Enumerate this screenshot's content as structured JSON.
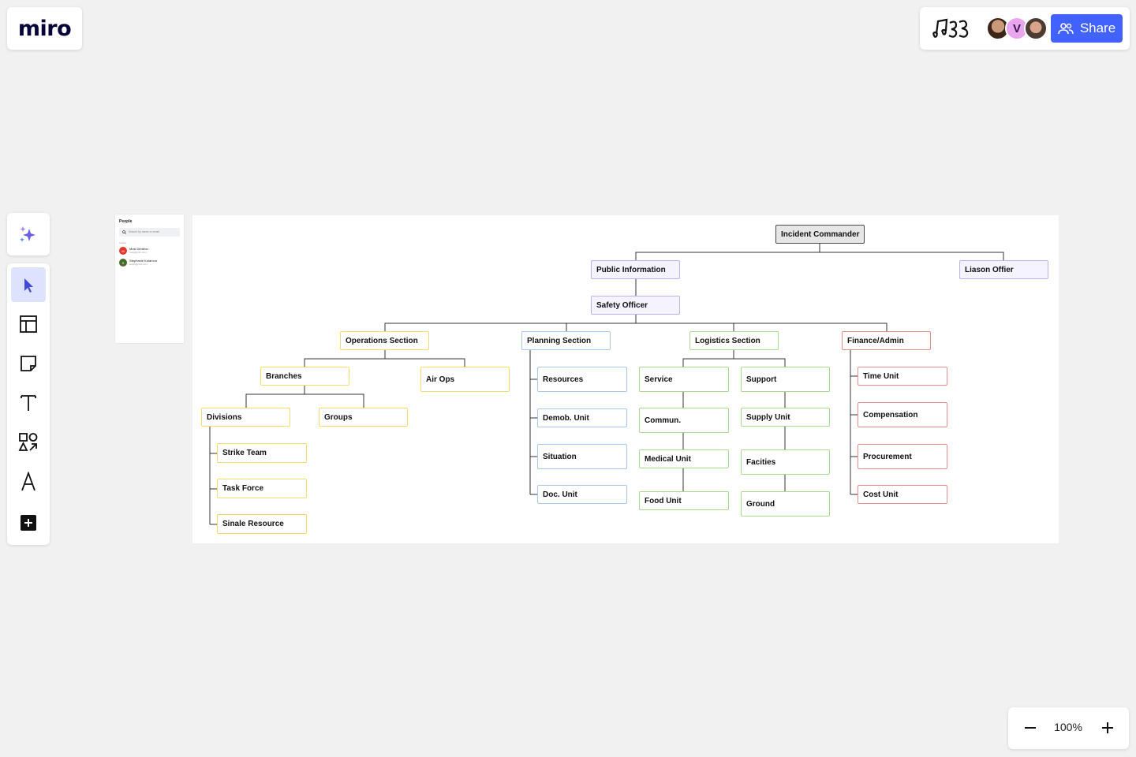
{
  "app": {
    "logo": "miro"
  },
  "header": {
    "board_logo_icon": "music-notes-icon",
    "avatars": [
      {
        "name": "user-avatar-1",
        "initial": ""
      },
      {
        "name": "user-avatar-2",
        "initial": "V"
      },
      {
        "name": "user-avatar-3",
        "initial": ""
      }
    ],
    "share_label": "Share",
    "colors": {
      "accent": "#4262ff"
    }
  },
  "toolbar": {
    "ai_icon": "sparkles-icon",
    "tools": [
      {
        "id": "select",
        "icon": "cursor-icon",
        "active": true
      },
      {
        "id": "templates",
        "icon": "layout-icon",
        "active": false
      },
      {
        "id": "sticky-note",
        "icon": "sticky-note-icon",
        "active": false
      },
      {
        "id": "text",
        "icon": "text-icon",
        "active": false
      },
      {
        "id": "shapes",
        "icon": "shapes-icon",
        "active": false
      },
      {
        "id": "pen",
        "icon": "pen-icon",
        "active": false
      },
      {
        "id": "more",
        "icon": "plus-icon",
        "active": false
      }
    ]
  },
  "zoom": {
    "level": "100%"
  },
  "people_panel": {
    "title": "People",
    "search_placeholder": "Search by name or email",
    "section": "Invited",
    "people": [
      {
        "initials": "M",
        "name": "Mosi Dimitrov",
        "email": "mosi@miro.com",
        "color": "#e2362b"
      },
      {
        "initials": "S",
        "name": "Stephanie Kolarova",
        "email": "steph@miro.com",
        "color": "#4a6b2b"
      }
    ]
  },
  "org_chart": {
    "incident_commander": "Incident Commander",
    "public_information": "Public Information",
    "liason_officer": "Liason Offier",
    "safety_officer": "Safety Officer",
    "operations_section": "Operations Section",
    "planning_section": "Planning Section",
    "logistics_section": "Logistics Section",
    "finance_admin": "Finance/Admin",
    "branches": "Branches",
    "air_ops": "Air Ops",
    "divisions": "Divisions",
    "groups": "Groups",
    "strike_team": "Strike Team",
    "task_force": "Task Force",
    "single_resource": "Sinale Resource",
    "resources": "Resources",
    "demob_unit": "Demob. Unit",
    "situation": "Situation",
    "doc_unit": "Doc. Unit",
    "service": "Service",
    "commun": "Commun.",
    "medical_unit": "Medical Unit",
    "food_unit": "Food Unit",
    "support": "Support",
    "supply_unit": "Supply Unit",
    "facities": "Facities",
    "ground": "Ground",
    "time_unit": "Time Unit",
    "compensation": "Compensation",
    "procurement": "Procurement",
    "cost_unit": "Cost Unit"
  }
}
